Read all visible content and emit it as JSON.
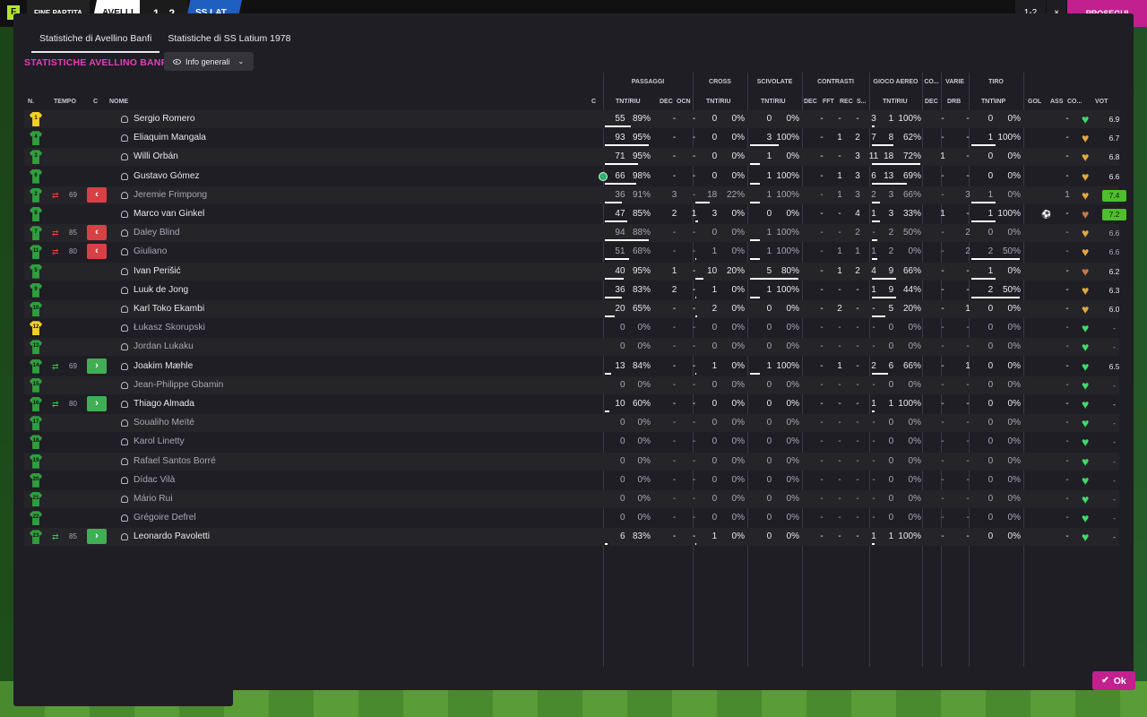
{
  "topbar": {
    "logo": "F",
    "end_label": "FINE PARTITA",
    "home": "AVELLI",
    "score": "1 - 2",
    "away": "SS LAT",
    "right_a": "1-2",
    "right_b": "×",
    "continue": "PROSEGUI"
  },
  "tabs": [
    "Statistiche di Avellino Banfi",
    "Statistiche di SS Latium 1978"
  ],
  "section_title": "STATISTICHE AVELLINO BANFI",
  "view_dropdown": "Info generali",
  "group_headers": {
    "passaggi": "PASSAGGI",
    "cross": "CROSS",
    "scivolate": "SCIVOLATE",
    "contrasti": "CONTRASTI",
    "gioco_aereo": "GIOCO AEREO",
    "co": "CO...",
    "varie": "VARIE",
    "tiro": "TIRO"
  },
  "columns": {
    "n": "N.",
    "tempo": "TEMPO",
    "c1": "C",
    "nome": "NOME",
    "c2": "C",
    "pass_tr": "TNT/RIU",
    "dec": "DEC",
    "ocn": "OCN",
    "cross_tr": "TNT/RIU",
    "sciv_tr": "TNT/RIU",
    "cont_dec": "DEC",
    "fft": "FFT",
    "rec": "REC",
    "s": "S...",
    "air_tr": "TNT/RIU",
    "co_dec": "DEC",
    "drb": "DRB",
    "tiro_tr": "TNT\\INP",
    "gol": "GOL",
    "ass": "ASS",
    "co2": "CO...",
    "vot": "VOT"
  },
  "ok_label": "Ok",
  "players": [
    {
      "num": "1",
      "gk": true,
      "name": "Sergio Romero",
      "dim": false,
      "sub": null,
      "min": "",
      "cap": false,
      "pa": "55",
      "pp": "89%",
      "pdec": "-",
      "pocn": "-",
      "ca": "0",
      "cp": "0%",
      "sa": "0",
      "sp": "0%",
      "tdec": "-",
      "tfft": "-",
      "trec": "-",
      "ts": "3",
      "aa": "1",
      "ap": "100%",
      "cdec": "-",
      "drb": "-",
      "sha": "0",
      "shp": "0%",
      "gol": "",
      "ass": "-",
      "morale": "g",
      "vot": "6.9",
      "vot_hi": false
    },
    {
      "num": "4",
      "gk": false,
      "name": "Eliaquim Mangala",
      "dim": false,
      "sub": null,
      "min": "",
      "cap": false,
      "pa": "93",
      "pp": "95%",
      "pdec": "-",
      "pocn": "-",
      "ca": "0",
      "cp": "0%",
      "sa": "3",
      "sp": "100%",
      "tdec": "-",
      "tfft": "1",
      "trec": "2",
      "ts": "7",
      "aa": "8",
      "ap": "62%",
      "cdec": "-",
      "drb": "-",
      "sha": "1",
      "shp": "100%",
      "gol": "",
      "ass": "-",
      "morale": "o",
      "vot": "6.7",
      "vot_hi": false
    },
    {
      "num": "3",
      "gk": false,
      "name": "Willi Orbán",
      "dim": false,
      "sub": null,
      "min": "",
      "cap": false,
      "pa": "71",
      "pp": "95%",
      "pdec": "-",
      "pocn": "-",
      "ca": "0",
      "cp": "0%",
      "sa": "1",
      "sp": "0%",
      "tdec": "-",
      "tfft": "-",
      "trec": "3",
      "ts": "11",
      "aa": "18",
      "ap": "72%",
      "cdec": "1",
      "drb": "-",
      "sha": "0",
      "shp": "0%",
      "gol": "",
      "ass": "-",
      "morale": "o",
      "vot": "6.8",
      "vot_hi": false
    },
    {
      "num": "6",
      "gk": false,
      "name": "Gustavo Gómez",
      "dim": false,
      "sub": null,
      "min": "",
      "cap": true,
      "pa": "66",
      "pp": "98%",
      "pdec": "-",
      "pocn": "-",
      "ca": "0",
      "cp": "0%",
      "sa": "1",
      "sp": "100%",
      "tdec": "-",
      "tfft": "1",
      "trec": "3",
      "ts": "6",
      "aa": "13",
      "ap": "69%",
      "cdec": "-",
      "drb": "-",
      "sha": "0",
      "shp": "0%",
      "gol": "",
      "ass": "-",
      "morale": "o",
      "vot": "6.6",
      "vot_hi": false
    },
    {
      "num": "2",
      "gk": false,
      "name": "Jeremie Frimpong",
      "dim": true,
      "sub": "out",
      "min": "69",
      "cap": false,
      "pa": "36",
      "pp": "91%",
      "pdec": "3",
      "pocn": "-",
      "ca": "18",
      "cp": "22%",
      "sa": "1",
      "sp": "100%",
      "tdec": "-",
      "tfft": "1",
      "trec": "3",
      "ts": "2",
      "aa": "3",
      "ap": "66%",
      "cdec": "-",
      "drb": "3",
      "sha": "1",
      "shp": "0%",
      "gol": "",
      "ass": "1",
      "morale": "o",
      "vot": "7.4",
      "vot_hi": true
    },
    {
      "num": "8",
      "gk": false,
      "name": "Marco van Ginkel",
      "dim": false,
      "sub": null,
      "min": "",
      "cap": false,
      "pa": "47",
      "pp": "85%",
      "pdec": "2",
      "pocn": "1",
      "ca": "3",
      "cp": "0%",
      "sa": "0",
      "sp": "0%",
      "tdec": "-",
      "tfft": "-",
      "trec": "4",
      "ts": "1",
      "aa": "3",
      "ap": "33%",
      "cdec": "1",
      "drb": "-",
      "sha": "1",
      "shp": "100%",
      "gol": "⚽",
      "ass": "-",
      "morale": "b",
      "vot": "7.2",
      "vot_hi": true
    },
    {
      "num": "7",
      "gk": false,
      "name": "Daley Blind",
      "dim": true,
      "sub": "out",
      "min": "85",
      "cap": false,
      "pa": "94",
      "pp": "88%",
      "pdec": "-",
      "pocn": "-",
      "ca": "0",
      "cp": "0%",
      "sa": "1",
      "sp": "100%",
      "tdec": "-",
      "tfft": "-",
      "trec": "2",
      "ts": "-",
      "aa": "2",
      "ap": "50%",
      "cdec": "-",
      "drb": "2",
      "sha": "0",
      "shp": "0%",
      "gol": "",
      "ass": "-",
      "morale": "o",
      "vot": "6.6",
      "vot_hi": false
    },
    {
      "num": "11",
      "gk": false,
      "name": "Giuliano",
      "dim": true,
      "sub": "out",
      "min": "80",
      "cap": false,
      "pa": "51",
      "pp": "68%",
      "pdec": "-",
      "pocn": "-",
      "ca": "1",
      "cp": "0%",
      "sa": "1",
      "sp": "100%",
      "tdec": "-",
      "tfft": "1",
      "trec": "1",
      "ts": "1",
      "aa": "2",
      "ap": "0%",
      "cdec": "-",
      "drb": "2",
      "sha": "2",
      "shp": "50%",
      "gol": "",
      "ass": "-",
      "morale": "o",
      "vot": "6.6",
      "vot_hi": false
    },
    {
      "num": "5",
      "gk": false,
      "name": "Ivan Perišić",
      "dim": false,
      "sub": null,
      "min": "",
      "cap": false,
      "pa": "40",
      "pp": "95%",
      "pdec": "1",
      "pocn": "-",
      "ca": "10",
      "cp": "20%",
      "sa": "5",
      "sp": "80%",
      "tdec": "-",
      "tfft": "1",
      "trec": "2",
      "ts": "4",
      "aa": "9",
      "ap": "66%",
      "cdec": "-",
      "drb": "-",
      "sha": "1",
      "shp": "0%",
      "gol": "",
      "ass": "-",
      "morale": "b",
      "vot": "6.2",
      "vot_hi": false
    },
    {
      "num": "9",
      "gk": false,
      "name": "Luuk de Jong",
      "dim": false,
      "sub": null,
      "min": "",
      "cap": false,
      "pa": "36",
      "pp": "83%",
      "pdec": "2",
      "pocn": "-",
      "ca": "1",
      "cp": "0%",
      "sa": "1",
      "sp": "100%",
      "tdec": "-",
      "tfft": "-",
      "trec": "-",
      "ts": "1",
      "aa": "9",
      "ap": "44%",
      "cdec": "-",
      "drb": "-",
      "sha": "2",
      "shp": "50%",
      "gol": "",
      "ass": "-",
      "morale": "o",
      "vot": "6.3",
      "vot_hi": false
    },
    {
      "num": "10",
      "gk": false,
      "name": "Karl Toko Ekambi",
      "dim": false,
      "sub": null,
      "min": "",
      "cap": false,
      "pa": "20",
      "pp": "65%",
      "pdec": "-",
      "pocn": "-",
      "ca": "2",
      "cp": "0%",
      "sa": "0",
      "sp": "0%",
      "tdec": "-",
      "tfft": "2",
      "trec": "-",
      "ts": "-",
      "aa": "5",
      "ap": "20%",
      "cdec": "-",
      "drb": "1",
      "sha": "0",
      "shp": "0%",
      "gol": "",
      "ass": "-",
      "morale": "o",
      "vot": "6.0",
      "vot_hi": false
    },
    {
      "num": "12",
      "gk": true,
      "name": "Łukasz Skorupski",
      "dim": true,
      "sub": null,
      "min": "",
      "cap": false,
      "pa": "0",
      "pp": "0%",
      "pdec": "-",
      "pocn": "-",
      "ca": "0",
      "cp": "0%",
      "sa": "0",
      "sp": "0%",
      "tdec": "-",
      "tfft": "-",
      "trec": "-",
      "ts": "-",
      "aa": "0",
      "ap": "0%",
      "cdec": "-",
      "drb": "-",
      "sha": "0",
      "shp": "0%",
      "gol": "",
      "ass": "-",
      "morale": "g",
      "vot": "-",
      "vot_hi": false
    },
    {
      "num": "13",
      "gk": false,
      "name": "Jordan Lukaku",
      "dim": true,
      "sub": null,
      "min": "",
      "cap": false,
      "pa": "0",
      "pp": "0%",
      "pdec": "-",
      "pocn": "-",
      "ca": "0",
      "cp": "0%",
      "sa": "0",
      "sp": "0%",
      "tdec": "-",
      "tfft": "-",
      "trec": "-",
      "ts": "-",
      "aa": "0",
      "ap": "0%",
      "cdec": "-",
      "drb": "-",
      "sha": "0",
      "shp": "0%",
      "gol": "",
      "ass": "-",
      "morale": "g",
      "vot": "-",
      "vot_hi": false
    },
    {
      "num": "14",
      "gk": false,
      "name": "Joakim Mæhle",
      "dim": false,
      "sub": "in",
      "min": "69",
      "cap": false,
      "pa": "13",
      "pp": "84%",
      "pdec": "-",
      "pocn": "-",
      "ca": "1",
      "cp": "0%",
      "sa": "1",
      "sp": "100%",
      "tdec": "-",
      "tfft": "1",
      "trec": "-",
      "ts": "2",
      "aa": "6",
      "ap": "66%",
      "cdec": "-",
      "drb": "1",
      "sha": "0",
      "shp": "0%",
      "gol": "",
      "ass": "-",
      "morale": "g",
      "vot": "6.5",
      "vot_hi": false
    },
    {
      "num": "15",
      "gk": false,
      "name": "Jean-Philippe Gbamin",
      "dim": true,
      "sub": null,
      "min": "",
      "cap": false,
      "pa": "0",
      "pp": "0%",
      "pdec": "-",
      "pocn": "-",
      "ca": "0",
      "cp": "0%",
      "sa": "0",
      "sp": "0%",
      "tdec": "-",
      "tfft": "-",
      "trec": "-",
      "ts": "-",
      "aa": "0",
      "ap": "0%",
      "cdec": "-",
      "drb": "-",
      "sha": "0",
      "shp": "0%",
      "gol": "",
      "ass": "-",
      "morale": "g",
      "vot": "-",
      "vot_hi": false
    },
    {
      "num": "16",
      "gk": false,
      "name": "Thiago Almada",
      "dim": false,
      "sub": "in",
      "min": "80",
      "cap": false,
      "pa": "10",
      "pp": "60%",
      "pdec": "-",
      "pocn": "-",
      "ca": "0",
      "cp": "0%",
      "sa": "0",
      "sp": "0%",
      "tdec": "-",
      "tfft": "-",
      "trec": "-",
      "ts": "1",
      "aa": "1",
      "ap": "100%",
      "cdec": "-",
      "drb": "-",
      "sha": "0",
      "shp": "0%",
      "gol": "",
      "ass": "-",
      "morale": "g",
      "vot": "-",
      "vot_hi": false
    },
    {
      "num": "17",
      "gk": false,
      "name": "Soualiho Meïté",
      "dim": true,
      "sub": null,
      "min": "",
      "cap": false,
      "pa": "0",
      "pp": "0%",
      "pdec": "-",
      "pocn": "-",
      "ca": "0",
      "cp": "0%",
      "sa": "0",
      "sp": "0%",
      "tdec": "-",
      "tfft": "-",
      "trec": "-",
      "ts": "-",
      "aa": "0",
      "ap": "0%",
      "cdec": "-",
      "drb": "-",
      "sha": "0",
      "shp": "0%",
      "gol": "",
      "ass": "-",
      "morale": "g",
      "vot": "-",
      "vot_hi": false
    },
    {
      "num": "18",
      "gk": false,
      "name": "Karol Linetty",
      "dim": true,
      "sub": null,
      "min": "",
      "cap": false,
      "pa": "0",
      "pp": "0%",
      "pdec": "-",
      "pocn": "-",
      "ca": "0",
      "cp": "0%",
      "sa": "0",
      "sp": "0%",
      "tdec": "-",
      "tfft": "-",
      "trec": "-",
      "ts": "-",
      "aa": "0",
      "ap": "0%",
      "cdec": "-",
      "drb": "-",
      "sha": "0",
      "shp": "0%",
      "gol": "",
      "ass": "-",
      "morale": "g",
      "vot": "-",
      "vot_hi": false
    },
    {
      "num": "19",
      "gk": false,
      "name": "Rafael Santos Borré",
      "dim": true,
      "sub": null,
      "min": "",
      "cap": false,
      "pa": "0",
      "pp": "0%",
      "pdec": "-",
      "pocn": "-",
      "ca": "0",
      "cp": "0%",
      "sa": "0",
      "sp": "0%",
      "tdec": "-",
      "tfft": "-",
      "trec": "-",
      "ts": "-",
      "aa": "0",
      "ap": "0%",
      "cdec": "-",
      "drb": "-",
      "sha": "0",
      "shp": "0%",
      "gol": "",
      "ass": "-",
      "morale": "g",
      "vot": "-",
      "vot_hi": false
    },
    {
      "num": "20",
      "gk": false,
      "name": "Dídac Vilà",
      "dim": true,
      "sub": null,
      "min": "",
      "cap": false,
      "pa": "0",
      "pp": "0%",
      "pdec": "-",
      "pocn": "-",
      "ca": "0",
      "cp": "0%",
      "sa": "0",
      "sp": "0%",
      "tdec": "-",
      "tfft": "-",
      "trec": "-",
      "ts": "-",
      "aa": "0",
      "ap": "0%",
      "cdec": "-",
      "drb": "-",
      "sha": "0",
      "shp": "0%",
      "gol": "",
      "ass": "-",
      "morale": "g",
      "vot": "-",
      "vot_hi": false
    },
    {
      "num": "21",
      "gk": false,
      "name": "Mário Rui",
      "dim": true,
      "sub": null,
      "min": "",
      "cap": false,
      "pa": "0",
      "pp": "0%",
      "pdec": "-",
      "pocn": "-",
      "ca": "0",
      "cp": "0%",
      "sa": "0",
      "sp": "0%",
      "tdec": "-",
      "tfft": "-",
      "trec": "-",
      "ts": "-",
      "aa": "0",
      "ap": "0%",
      "cdec": "-",
      "drb": "-",
      "sha": "0",
      "shp": "0%",
      "gol": "",
      "ass": "-",
      "morale": "g",
      "vot": "-",
      "vot_hi": false
    },
    {
      "num": "22",
      "gk": false,
      "name": "Grégoire Defrel",
      "dim": true,
      "sub": null,
      "min": "",
      "cap": false,
      "pa": "0",
      "pp": "0%",
      "pdec": "-",
      "pocn": "-",
      "ca": "0",
      "cp": "0%",
      "sa": "0",
      "sp": "0%",
      "tdec": "-",
      "tfft": "-",
      "trec": "-",
      "ts": "-",
      "aa": "0",
      "ap": "0%",
      "cdec": "-",
      "drb": "-",
      "sha": "0",
      "shp": "0%",
      "gol": "",
      "ass": "-",
      "morale": "g",
      "vot": "-",
      "vot_hi": false
    },
    {
      "num": "23",
      "gk": false,
      "name": "Leonardo Pavoletti",
      "dim": false,
      "sub": "in",
      "min": "85",
      "cap": false,
      "pa": "6",
      "pp": "83%",
      "pdec": "-",
      "pocn": "-",
      "ca": "1",
      "cp": "0%",
      "sa": "0",
      "sp": "0%",
      "tdec": "-",
      "tfft": "-",
      "trec": "-",
      "ts": "1",
      "aa": "1",
      "ap": "100%",
      "cdec": "-",
      "drb": "-",
      "sha": "0",
      "shp": "0%",
      "gol": "",
      "ass": "-",
      "morale": "g",
      "vot": "-",
      "vot_hi": false
    }
  ]
}
